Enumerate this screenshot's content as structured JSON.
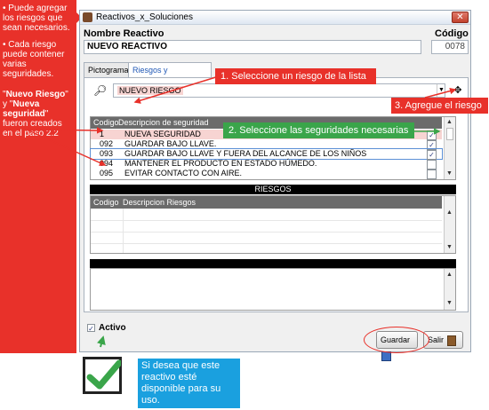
{
  "sidebar": {
    "bullet1": "• Puede agregar los riesgos que sean necesarios.",
    "bullet2": "• Cada riesgo puede contener varias seguridades.",
    "note_parts": [
      "\"",
      "Nuevo Riesgo",
      "\" y \"",
      "Nueva seguridad",
      "\" fueron creados en el paso 2.2"
    ]
  },
  "window": {
    "title": "Reactivos_x_Soluciones",
    "close": "✕",
    "name_label": "Nombre Reactivo",
    "code_label": "Código",
    "name_value": "NUEVO REACTIVO",
    "code_value": "0078"
  },
  "tabs": [
    "Pictogramas",
    "Riesgos y soluciones"
  ],
  "risk_select": {
    "value": "NUEVO RIESGO",
    "add_icon": "✥"
  },
  "security_table": {
    "headers": [
      "Codigo",
      "Descripcion de seguridad"
    ],
    "rows": [
      {
        "code": "1",
        "desc": "NUEVA SEGURIDAD",
        "checked": true
      },
      {
        "code": "092",
        "desc": "GUARDAR BAJO LLAVE.",
        "checked": true
      },
      {
        "code": "093",
        "desc": "GUARDAR BAJO LLAVE Y FUERA DEL ALCANCE DE LOS NIÑOS",
        "checked": true
      },
      {
        "code": "094",
        "desc": "MANTENER EL PRODUCTO EN ESTADO HÚMEDO.",
        "checked": false
      },
      {
        "code": "095",
        "desc": "EVITAR CONTACTO CON AIRE.",
        "checked": false
      }
    ]
  },
  "risks_section": {
    "title": "RIESGOS",
    "headers": [
      "Codigo",
      "Descripcion Riesgos"
    ]
  },
  "active": {
    "label": "Activo",
    "checked": true
  },
  "buttons": {
    "save": "Guardar",
    "exit": "Salir"
  },
  "callouts": {
    "c1": "1. Seleccione un riesgo de la lista",
    "c2": "2. Seleccione las seguridades necesarias",
    "c3": "3. Agregue el riesgo",
    "c4": "Si desea que este reactivo esté disponible para su uso."
  },
  "colors": {
    "red": "#e8312a",
    "green": "#3aa54a",
    "blue": "#1aa0df"
  }
}
